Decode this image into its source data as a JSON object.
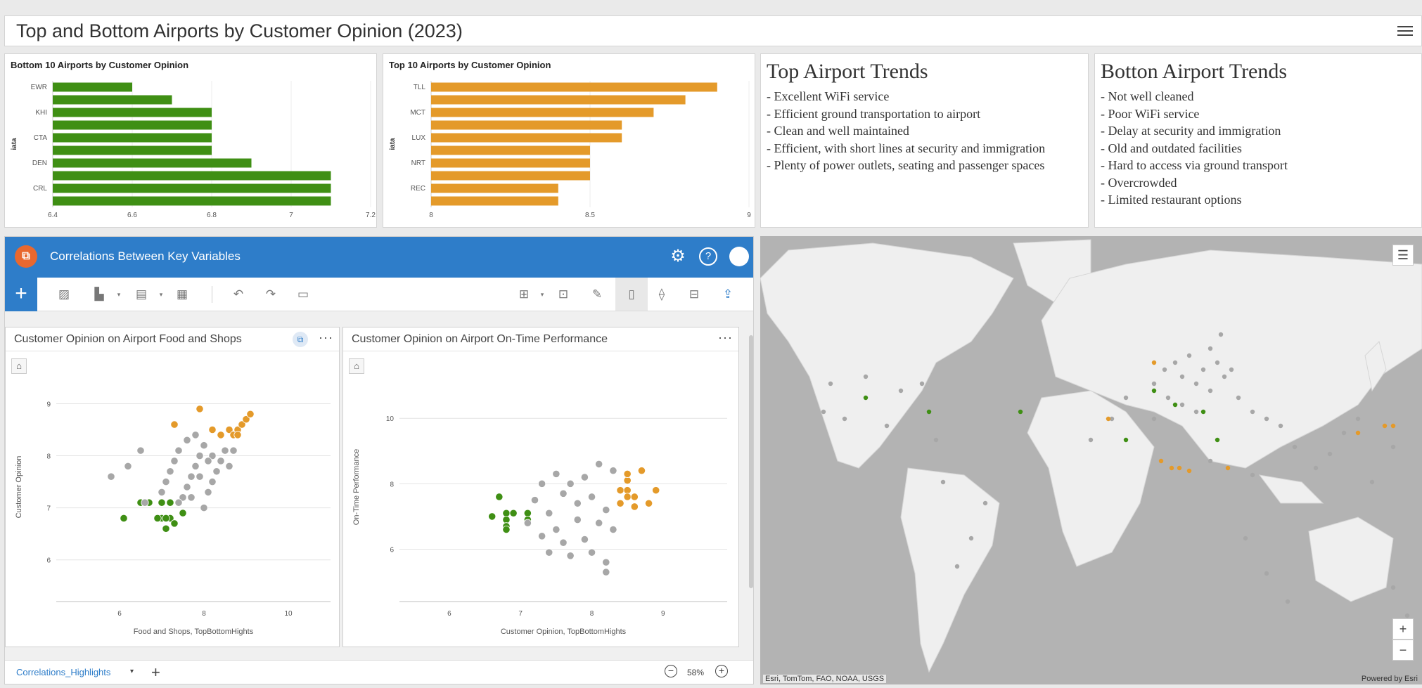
{
  "dashboard": {
    "title": "Top and Bottom Airports by Customer Opinion (2023)"
  },
  "bottom_chart": {
    "title": "Bottom 10 Airports by Customer Opinion",
    "ylabel": "iata",
    "x_ticks": [
      "6.4",
      "6.6",
      "6.8",
      "7",
      "7.2"
    ],
    "labels": [
      "EWR",
      "KHI",
      "CTA",
      "DEN",
      "CRL"
    ]
  },
  "top_chart": {
    "title": "Top 10 Airports by Customer Opinion",
    "ylabel": "iata",
    "x_ticks": [
      "8",
      "8.5",
      "9"
    ],
    "labels": [
      "TLL",
      "MCT",
      "LUX",
      "NRT",
      "REC"
    ]
  },
  "top_trends": {
    "title": "Top Airport Trends",
    "items": [
      "- Excellent WiFi service",
      "- Efficient ground transportation to airport",
      "- Clean and well maintained",
      "- Efficient, with short lines at security and immigration",
      "- Plenty of power outlets, seating and passenger spaces"
    ]
  },
  "bottom_trends": {
    "title": "Botton Airport Trends",
    "items": [
      "- Not well cleaned",
      "- Poor WiFi service",
      "- Delay at security and immigration",
      "- Old and outdated facilities",
      "- Hard to access via ground transport",
      "- Overcrowded",
      "- Limited restaurant options"
    ]
  },
  "insights": {
    "title": "Correlations Between Key Variables",
    "page_tab": "Correlations_Highlights",
    "zoom": "58%",
    "card1": {
      "title": "Customer Opinion on Airport Food and Shops",
      "xlabel": "Food and Shops, TopBottomHights",
      "ylabel": "Customer Opinion",
      "x_ticks": [
        "6",
        "8",
        "10"
      ],
      "y_ticks": [
        "9",
        "8",
        "7",
        "6"
      ]
    },
    "card2": {
      "title": "Customer Opinion on Airport On-Time Performance",
      "xlabel": "Customer Opinion, TopBottomHights",
      "ylabel": "On-Time Performance",
      "x_ticks": [
        "6",
        "7",
        "8",
        "9"
      ],
      "y_ticks": [
        "10",
        "8",
        "6"
      ]
    }
  },
  "map": {
    "attribution": "Esri, TomTom, FAO, NOAA, USGS",
    "powered": "Powered by Esri"
  },
  "colors": {
    "bottom": "#3f8f14",
    "top": "#e49a2a",
    "other": "#a7a7a7",
    "header": "#2e7dc9"
  },
  "chart_data": [
    {
      "type": "bar",
      "orientation": "horizontal",
      "title": "Bottom 10 Airports by Customer Opinion",
      "ylabel": "iata",
      "categories": [
        "EWR",
        "",
        "KHI",
        "",
        "CTA",
        "",
        "DEN",
        "",
        "CRL",
        ""
      ],
      "values": [
        6.6,
        6.7,
        6.8,
        6.8,
        6.8,
        6.8,
        6.9,
        7.1,
        7.1,
        7.1
      ],
      "xlim": [
        6.4,
        7.2
      ],
      "color": "#3f8f14"
    },
    {
      "type": "bar",
      "orientation": "horizontal",
      "title": "Top 10 Airports by Customer Opinion",
      "ylabel": "iata",
      "categories": [
        "TLL",
        "",
        "MCT",
        "",
        "LUX",
        "",
        "NRT",
        "",
        "REC",
        ""
      ],
      "values": [
        8.9,
        8.8,
        8.7,
        8.6,
        8.6,
        8.5,
        8.5,
        8.5,
        8.4,
        8.4
      ],
      "xlim": [
        8,
        9
      ],
      "color": "#e49a2a"
    },
    {
      "type": "scatter",
      "title": "Customer Opinion on Airport Food and Shops",
      "xlabel": "Food and Shops, TopBottomHights",
      "ylabel": "Customer Opinion",
      "xlim": [
        4.5,
        11
      ],
      "ylim": [
        5.2,
        9.6
      ],
      "series": [
        {
          "color": "#3f8f14",
          "points": [
            [
              6.1,
              6.8
            ],
            [
              6.5,
              7.1
            ],
            [
              6.7,
              7.1
            ],
            [
              7.0,
              7.1
            ],
            [
              7.2,
              7.1
            ],
            [
              7.5,
              6.9
            ],
            [
              7.0,
              6.8
            ],
            [
              7.2,
              6.8
            ],
            [
              7.1,
              6.6
            ],
            [
              7.3,
              6.7
            ],
            [
              6.9,
              6.8
            ],
            [
              7.1,
              6.8
            ]
          ]
        },
        {
          "color": "#e49a2a",
          "points": [
            [
              7.3,
              8.6
            ],
            [
              7.9,
              8.9
            ],
            [
              8.2,
              8.5
            ],
            [
              8.4,
              8.4
            ],
            [
              8.6,
              8.5
            ],
            [
              8.7,
              8.4
            ],
            [
              8.8,
              8.5
            ],
            [
              8.9,
              8.6
            ],
            [
              9.0,
              8.7
            ],
            [
              9.1,
              8.8
            ],
            [
              8.8,
              8.4
            ]
          ]
        },
        {
          "color": "#a7a7a7",
          "points": [
            [
              5.8,
              7.6
            ],
            [
              6.2,
              7.8
            ],
            [
              6.5,
              8.1
            ],
            [
              6.6,
              7.1
            ],
            [
              7.0,
              7.3
            ],
            [
              7.1,
              7.5
            ],
            [
              7.2,
              7.7
            ],
            [
              7.3,
              7.9
            ],
            [
              7.4,
              8.1
            ],
            [
              7.5,
              7.2
            ],
            [
              7.6,
              7.4
            ],
            [
              7.7,
              7.6
            ],
            [
              7.8,
              7.8
            ],
            [
              7.9,
              8.0
            ],
            [
              8.0,
              8.2
            ],
            [
              8.1,
              7.3
            ],
            [
              8.2,
              7.5
            ],
            [
              8.3,
              7.7
            ],
            [
              8.4,
              7.9
            ],
            [
              8.5,
              8.1
            ],
            [
              7.6,
              8.3
            ],
            [
              7.8,
              8.4
            ],
            [
              8.0,
              7.0
            ],
            [
              8.2,
              8.0
            ],
            [
              8.6,
              7.8
            ],
            [
              8.7,
              8.1
            ],
            [
              7.4,
              7.1
            ],
            [
              7.9,
              7.6
            ],
            [
              8.1,
              7.9
            ],
            [
              7.7,
              7.2
            ]
          ]
        }
      ]
    },
    {
      "type": "scatter",
      "title": "Customer Opinion on Airport On-Time Performance",
      "xlabel": "Customer Opinion, TopBottomHights",
      "ylabel": "On-Time Performance",
      "xlim": [
        5.3,
        9.9
      ],
      "ylim": [
        4.4,
        11.4
      ],
      "series": [
        {
          "color": "#3f8f14",
          "points": [
            [
              6.6,
              7.0
            ],
            [
              6.7,
              7.6
            ],
            [
              6.8,
              7.1
            ],
            [
              6.8,
              6.9
            ],
            [
              6.8,
              6.7
            ],
            [
              6.8,
              6.6
            ],
            [
              6.9,
              7.1
            ],
            [
              7.1,
              7.1
            ],
            [
              7.1,
              6.9
            ]
          ]
        },
        {
          "color": "#e49a2a",
          "points": [
            [
              8.4,
              7.4
            ],
            [
              8.4,
              7.8
            ],
            [
              8.5,
              7.8
            ],
            [
              8.5,
              7.6
            ],
            [
              8.5,
              8.1
            ],
            [
              8.5,
              8.3
            ],
            [
              8.6,
              7.6
            ],
            [
              8.6,
              7.3
            ],
            [
              8.7,
              8.4
            ],
            [
              8.8,
              7.4
            ],
            [
              8.9,
              7.8
            ]
          ]
        },
        {
          "color": "#a7a7a7",
          "points": [
            [
              7.1,
              6.8
            ],
            [
              7.2,
              7.5
            ],
            [
              7.3,
              8.0
            ],
            [
              7.3,
              6.4
            ],
            [
              7.4,
              7.1
            ],
            [
              7.4,
              5.9
            ],
            [
              7.5,
              8.3
            ],
            [
              7.5,
              6.6
            ],
            [
              7.6,
              7.7
            ],
            [
              7.6,
              6.2
            ],
            [
              7.7,
              8.0
            ],
            [
              7.7,
              5.8
            ],
            [
              7.8,
              6.9
            ],
            [
              7.8,
              7.4
            ],
            [
              7.9,
              8.2
            ],
            [
              7.9,
              6.3
            ],
            [
              8.0,
              7.6
            ],
            [
              8.0,
              5.9
            ],
            [
              8.1,
              6.8
            ],
            [
              8.1,
              8.6
            ],
            [
              8.2,
              7.2
            ],
            [
              8.2,
              5.6
            ],
            [
              8.3,
              8.4
            ],
            [
              8.3,
              6.6
            ],
            [
              8.2,
              5.3
            ]
          ]
        }
      ]
    }
  ]
}
